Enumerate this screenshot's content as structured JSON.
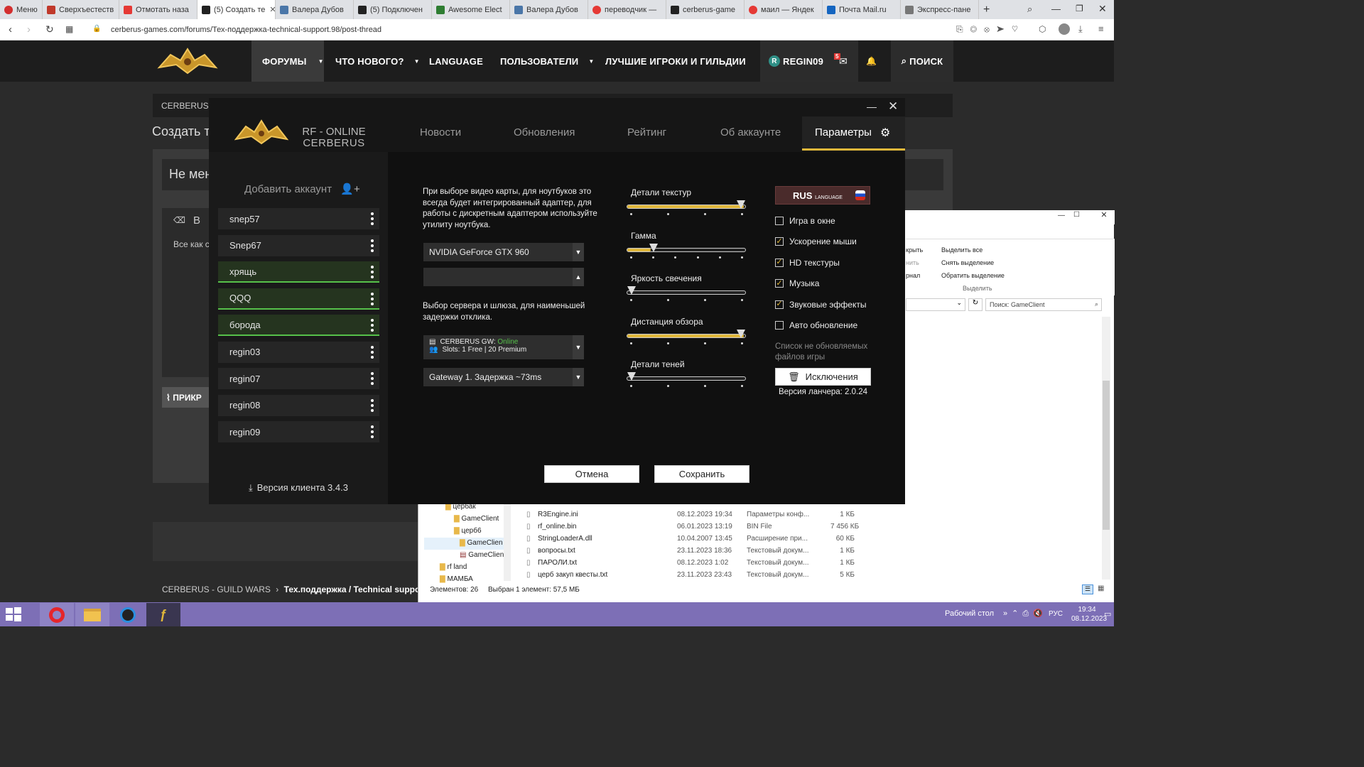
{
  "browser": {
    "tabs": [
      {
        "label": "Меню",
        "color": "#d32f2f"
      },
      {
        "label": "Сверхъестеств",
        "color": "#c0392b"
      },
      {
        "label": "Отмотать наза",
        "color": "#e53935"
      },
      {
        "label": "(5) Создать те",
        "color": "#222222",
        "active": true
      },
      {
        "label": "Валера Дубов",
        "color": "#4a76a8"
      },
      {
        "label": "(5) Подключен",
        "color": "#222222"
      },
      {
        "label": "Awesome Elect",
        "color": "#2e7d32"
      },
      {
        "label": "Валера Дубов",
        "color": "#4a76a8"
      },
      {
        "label": "переводчик —",
        "color": "#e53935"
      },
      {
        "label": "cerberus-game",
        "color": "#222222"
      },
      {
        "label": "маил — Яндек",
        "color": "#e53935"
      },
      {
        "label": "Почта Mail.ru",
        "color": "#1565c0"
      },
      {
        "label": "Экспресс-пане",
        "color": "#777777"
      }
    ],
    "url": "cerberus-games.com/forums/Тех-поддержка-technical-support.98/post-thread"
  },
  "forum": {
    "nav": [
      "ФОРУМЫ",
      "ЧТО НОВОГО?",
      "LANGUAGE",
      "ПОЛЬЗОВАТЕЛИ",
      "ЛУЧШИЕ ИГРОКИ И ГИЛЬДИИ",
      "REGIN09",
      "ПОИСК"
    ],
    "user_initial": "R",
    "inbox_badge": "5",
    "breadcrumb_short": "CERBERUS - ",
    "page_title_partial": "Создать т",
    "thread_title_partial": "Не мен",
    "editor_text_partial": "Все как с",
    "attach_partial": "ПРИКР",
    "footer_breadcrumb": "CERBERUS - GUILD WARS",
    "footer_section": "Тех.поддержка / Technical support"
  },
  "launcher": {
    "logo_line1": "RF - ONLINE",
    "logo_line2": "CERBERUS",
    "tabs": [
      "Новости",
      "Обновления",
      "Рейтинг",
      "Об аккаунте",
      "Параметры"
    ],
    "active_tab": "Параметры",
    "add_account": "Добавить аккаунт",
    "accounts": [
      {
        "name": "snep57",
        "selected": false
      },
      {
        "name": "Snep67",
        "selected": false
      },
      {
        "name": "хрящь",
        "selected": true
      },
      {
        "name": "QQQ",
        "selected": true
      },
      {
        "name": "борода",
        "selected": true
      },
      {
        "name": "regin03",
        "selected": false
      },
      {
        "name": "regin07",
        "selected": false
      },
      {
        "name": "regin08",
        "selected": false
      },
      {
        "name": "regin09",
        "selected": false
      }
    ],
    "client_version": "Версия клиента 3.4.3",
    "gpu_note": "При выборе видео карты, для ноутбуков это всегда будет интегрированный адаптер, для работы с дискретным адаптером используйте утилиту ноутбука.",
    "gpu_selected": "NVIDIA GeForce GTX 960",
    "gpu_secondary": "",
    "server_note": "Выбор сервера и шлюза, для наименьшей задержки отклика.",
    "server": {
      "name": "CERBERUS GW:",
      "status": "Online",
      "slots": "Slots: 1 Free | 20 Premium"
    },
    "gateway": "Gateway 1. Задержка ~73ms",
    "sliders": [
      {
        "label": "Детали текстур",
        "value": 1.0,
        "ticks": 4
      },
      {
        "label": "Гамма",
        "value": 0.2,
        "ticks": 6
      },
      {
        "label": "Яркость свечения",
        "value": 0.0,
        "ticks": 4
      },
      {
        "label": "Дистанция обзора",
        "value": 1.0,
        "ticks": 4
      },
      {
        "label": "Детали теней",
        "value": 0.0,
        "ticks": 4
      }
    ],
    "language": {
      "code": "RUS",
      "word": "LANGUAGE"
    },
    "options": [
      {
        "label": "Игра в окне",
        "checked": false
      },
      {
        "label": "Ускорение мыши",
        "checked": true
      },
      {
        "label": "HD текстуры",
        "checked": true
      },
      {
        "label": "Музыка",
        "checked": true
      },
      {
        "label": "Звуковые эффекты",
        "checked": true
      },
      {
        "label": "Авто обновление",
        "checked": false
      }
    ],
    "exclusions_note": "Список не обновляемых файлов игры",
    "exclusions_button": "Исключения",
    "launcher_version": "Версия ланчера: 2.0.24",
    "cancel": "Отмена",
    "save": "Сохранить"
  },
  "explorer": {
    "ribbon": [
      "крыть",
      "нить",
      "рнал",
      "Выделить все",
      "Снять выделение",
      "Обратить выделение",
      "Выделить"
    ],
    "search_placeholder": "Поиск: GameClient",
    "tree": [
      "цербак",
      "GameClient",
      "церб6",
      "GameClien",
      "GameClien",
      "rf land",
      "МАМБА"
    ],
    "files": [
      {
        "name": "R3Engine.ini",
        "date": "08.12.2023 19:34",
        "type": "Параметры конф...",
        "size": "1 КБ"
      },
      {
        "name": "rf_online.bin",
        "date": "06.01.2023 13:19",
        "type": "BIN File",
        "size": "7 456 КБ"
      },
      {
        "name": "StringLoaderA.dll",
        "date": "10.04.2007 13:45",
        "type": "Расширение при...",
        "size": "60 КБ"
      },
      {
        "name": "вопросы.txt",
        "date": "23.11.2023 18:36",
        "type": "Текстовый докум...",
        "size": "1 КБ"
      },
      {
        "name": "ПАРОЛИ.txt",
        "date": "08.12.2023 1:02",
        "type": "Текстовый докум...",
        "size": "1 КБ"
      },
      {
        "name": "церб закуп квесты.txt",
        "date": "23.11.2023 23:43",
        "type": "Текстовый докум...",
        "size": "5 КБ"
      }
    ],
    "status_count": "Элементов: 26",
    "status_selected": "Выбран 1 элемент: 57,5 МБ"
  },
  "taskbar": {
    "desktop": "Рабочий стол",
    "lang": "РУС",
    "time": "19:34",
    "date": "08.12.2023"
  },
  "colors": {
    "accent": "#e0b73a",
    "online": "#56c14a",
    "taskbar": "#7d6fb6"
  }
}
